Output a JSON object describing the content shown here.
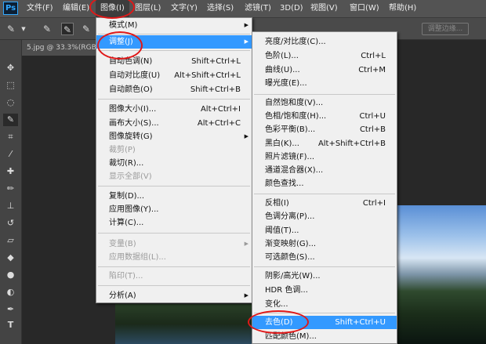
{
  "menubar": {
    "logo": "Ps",
    "items": [
      {
        "label": "文件(F)"
      },
      {
        "label": "编辑(E)"
      },
      {
        "label": "图像(I)"
      },
      {
        "label": "图层(L)"
      },
      {
        "label": "文字(Y)"
      },
      {
        "label": "选择(S)"
      },
      {
        "label": "滤镜(T)"
      },
      {
        "label": "3D(D)"
      },
      {
        "label": "视图(V)"
      },
      {
        "label": "窗口(W)"
      },
      {
        "label": "帮助(H)"
      }
    ]
  },
  "options_bar": {
    "adjust_edge_button": "调整边缘..."
  },
  "document": {
    "tab_title": "5.jpg @ 33.3%(RGB"
  },
  "image_menu": {
    "items": [
      {
        "label": "模式(M)",
        "shortcut": ""
      },
      {
        "label": "调整(J)",
        "shortcut": ""
      },
      {
        "label": "自动色调(N)",
        "shortcut": "Shift+Ctrl+L"
      },
      {
        "label": "自动对比度(U)",
        "shortcut": "Alt+Shift+Ctrl+L"
      },
      {
        "label": "自动颜色(O)",
        "shortcut": "Shift+Ctrl+B"
      },
      {
        "label": "图像大小(I)...",
        "shortcut": "Alt+Ctrl+I"
      },
      {
        "label": "画布大小(S)...",
        "shortcut": "Alt+Ctrl+C"
      },
      {
        "label": "图像旋转(G)",
        "shortcut": ""
      },
      {
        "label": "裁剪(P)",
        "shortcut": ""
      },
      {
        "label": "裁切(R)...",
        "shortcut": ""
      },
      {
        "label": "显示全部(V)",
        "shortcut": ""
      },
      {
        "label": "复制(D)...",
        "shortcut": ""
      },
      {
        "label": "应用图像(Y)...",
        "shortcut": ""
      },
      {
        "label": "计算(C)...",
        "shortcut": ""
      },
      {
        "label": "变量(B)",
        "shortcut": ""
      },
      {
        "label": "应用数据组(L)...",
        "shortcut": ""
      },
      {
        "label": "陷印(T)...",
        "shortcut": ""
      },
      {
        "label": "分析(A)",
        "shortcut": ""
      }
    ]
  },
  "adjust_menu": {
    "items": [
      {
        "label": "亮度/对比度(C)...",
        "shortcut": ""
      },
      {
        "label": "色阶(L)...",
        "shortcut": "Ctrl+L"
      },
      {
        "label": "曲线(U)...",
        "shortcut": "Ctrl+M"
      },
      {
        "label": "曝光度(E)...",
        "shortcut": ""
      },
      {
        "label": "自然饱和度(V)...",
        "shortcut": ""
      },
      {
        "label": "色相/饱和度(H)...",
        "shortcut": "Ctrl+U"
      },
      {
        "label": "色彩平衡(B)...",
        "shortcut": "Ctrl+B"
      },
      {
        "label": "黑白(K)...",
        "shortcut": "Alt+Shift+Ctrl+B"
      },
      {
        "label": "照片滤镜(F)...",
        "shortcut": ""
      },
      {
        "label": "通道混合器(X)...",
        "shortcut": ""
      },
      {
        "label": "颜色查找...",
        "shortcut": ""
      },
      {
        "label": "反相(I)",
        "shortcut": "Ctrl+I"
      },
      {
        "label": "色调分离(P)...",
        "shortcut": ""
      },
      {
        "label": "阈值(T)...",
        "shortcut": ""
      },
      {
        "label": "渐变映射(G)...",
        "shortcut": ""
      },
      {
        "label": "可选颜色(S)...",
        "shortcut": ""
      },
      {
        "label": "阴影/高光(W)...",
        "shortcut": ""
      },
      {
        "label": "HDR 色调...",
        "shortcut": ""
      },
      {
        "label": "变化...",
        "shortcut": ""
      },
      {
        "label": "去色(D)",
        "shortcut": "Shift+Ctrl+U"
      },
      {
        "label": "匹配颜色(M)...",
        "shortcut": ""
      }
    ]
  },
  "colors": {
    "highlight": "#3399ff",
    "annotation": "#e01818",
    "menubar": "#535353"
  }
}
